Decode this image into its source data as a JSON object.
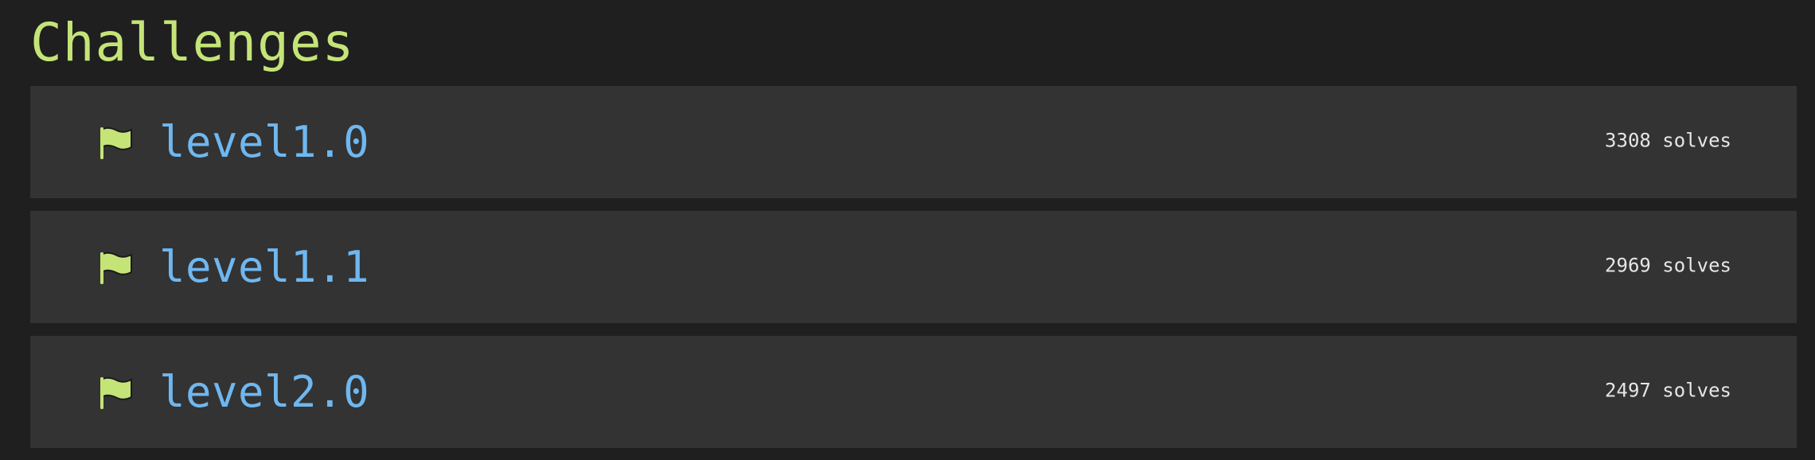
{
  "page": {
    "title": "Challenges"
  },
  "challenges": [
    {
      "icon": "flag-icon",
      "name": "level1.0",
      "solves": "3308 solves"
    },
    {
      "icon": "flag-icon",
      "name": "level1.1",
      "solves": "2969 solves"
    },
    {
      "icon": "flag-icon",
      "name": "level2.0",
      "solves": "2497 solves"
    }
  ],
  "colors": {
    "background": "#1f1f1f",
    "row": "#333333",
    "title": "#c5e478",
    "challenge_name": "#6fb7f0",
    "flag": "#c5e478",
    "solve_count": "#e6e6e6"
  }
}
